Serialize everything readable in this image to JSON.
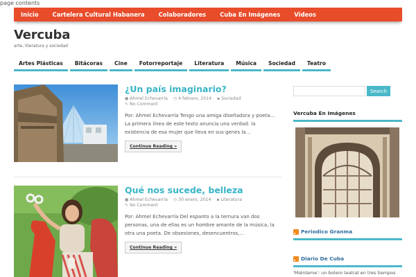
{
  "page_label": "page contents",
  "top_nav": [
    {
      "label": "Inicio"
    },
    {
      "label": "Cartelera Cultural Habanera"
    },
    {
      "label": "Colaboradores"
    },
    {
      "label": "Cuba En Imágenes"
    },
    {
      "label": "Videos"
    }
  ],
  "site": {
    "title": "Vercuba",
    "tagline": "arte, literatura y sociedad"
  },
  "categories": [
    {
      "label": "Artes Plásticas"
    },
    {
      "label": "Bitácoras"
    },
    {
      "label": "Cine"
    },
    {
      "label": "Fotorreportaje"
    },
    {
      "label": "Literatura"
    },
    {
      "label": "Música"
    },
    {
      "label": "Sociedad"
    },
    {
      "label": "Teatro"
    }
  ],
  "posts": [
    {
      "title": "¿Un país imaginario?",
      "author": "Ahmel Echevarría",
      "date": "4 febrero, 2014",
      "category": "Sociedad",
      "comments": "No Comment",
      "excerpt": "Por: Ahmel Echevarría  Tengo una amiga diseñadora y poeta… La primera línea de este texto anuncia una verdad: la existencia de esa mujer que lleva en sus genes la…",
      "read_more": "Continue Reading »"
    },
    {
      "title": "Qué nos sucede, belleza",
      "author": "Ahmel Echevarría",
      "date": "30 enero, 2014",
      "category": "Literatura",
      "comments": "No Comment",
      "excerpt": "  Por: Ahmel Echevarría Del espanto a la ternura van dos personas, una de ellas es un hombre amante de la música, la otra una poeta. De obsesiones, desencuentros,…",
      "read_more": "Continue Reading »"
    }
  ],
  "sidebar": {
    "search_button": "Search",
    "gallery_title": "Vercuba En Imágenes",
    "feed1_title": "Periodico Granma",
    "feed2_title": "Diario De Cuba",
    "feed2_item": "'Miénteme': un bolero teatral en tres tiempos"
  },
  "colors": {
    "accent_red": "#e84c2b",
    "accent_teal": "#4ab8c8",
    "title_teal": "#38b4c7"
  }
}
